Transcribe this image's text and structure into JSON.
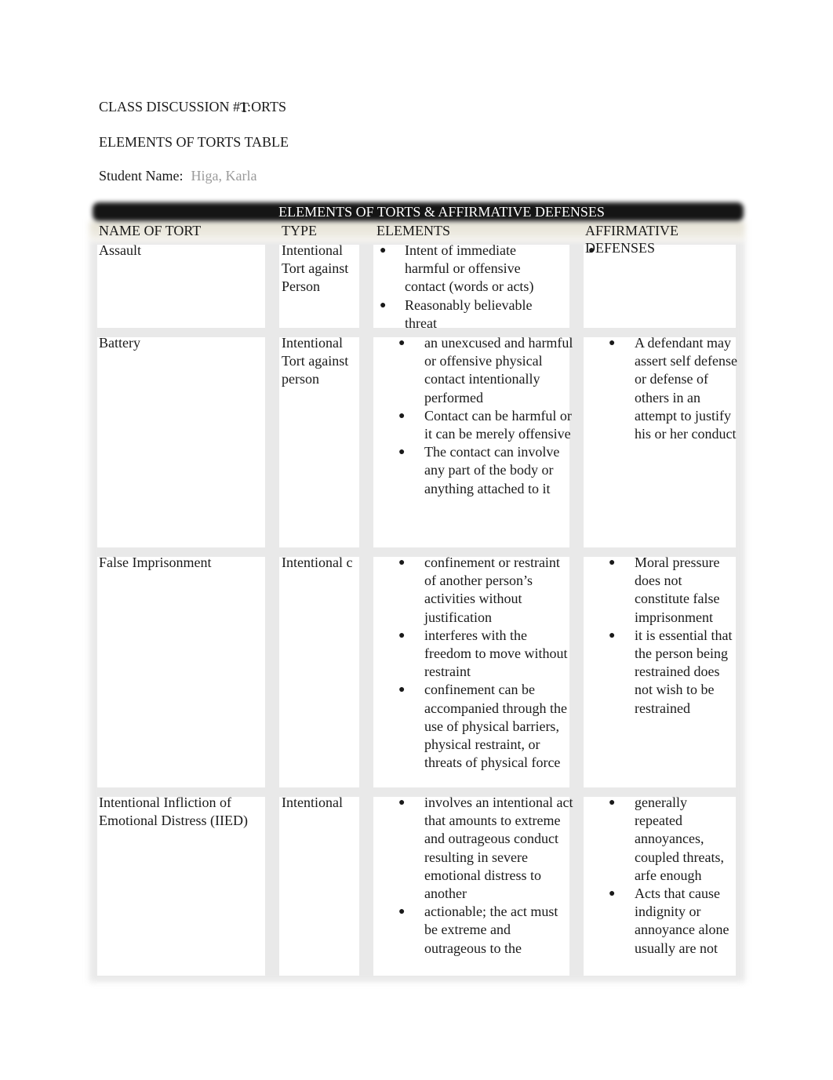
{
  "header": {
    "title_prefix": "CLASS DISCUSSION #",
    "title_overlap_a": "1:",
    "title_overlap_b": "T",
    "title_suffix": "ORTS",
    "subtitle": "ELEMENTS OF TORTS TABLE",
    "student_label": "Student Name:",
    "student_value": "Higa, Karla"
  },
  "table": {
    "title": "ELEMENTS OF TORTS & AFFIRMATIVE DEFENSES",
    "columns": [
      "NAME OF TORT",
      "TYPE",
      "ELEMENTS",
      "AFFIRMATIVE DEFENSES"
    ],
    "rows": [
      {
        "name": "Assault",
        "type": "Intentional Tort against Person",
        "elements": [
          "Intent of immediate harmful or offensive contact (words or acts)",
          "Reasonably believable threat"
        ],
        "defenses": [
          ""
        ]
      },
      {
        "name": "Battery",
        "type": "Intentional Tort against person",
        "elements": [
          "an unexcused and harmful or offensive physical contact intentionally performed",
          "Contact can be harmful or it can be merely offensive",
          "The contact can involve any part of the body or anything attached to it"
        ],
        "defenses": [
          "A defendant may assert self defense or defense of others in an attempt to justify his or her conduct"
        ]
      },
      {
        "name": "False Imprisonment",
        "type": "Intentional c",
        "elements": [
          "confinement or restraint of another person’s activities without justification",
          "interferes with the freedom to move without restraint",
          "confinement can be accompanied through the use of physical barriers, physical restraint, or threats of physical force"
        ],
        "defenses": [
          "Moral pressure does not constitute false imprisonment",
          "it is essential that the person being restrained does not wish to be restrained"
        ]
      },
      {
        "name": "Intentional Infliction of Emotional Distress (IIED)",
        "type": "Intentional",
        "elements": [
          "involves an intentional act that amounts to extreme and outrageous conduct resulting in severe emotional distress to another",
          "actionable; the act must be extreme and outrageous to the"
        ],
        "defenses": [
          "generally repeated annoyances, coupled threats, arfe enough",
          "Acts that cause indignity or annoyance alone usually are not"
        ]
      }
    ]
  },
  "bullet_glyph": "●"
}
